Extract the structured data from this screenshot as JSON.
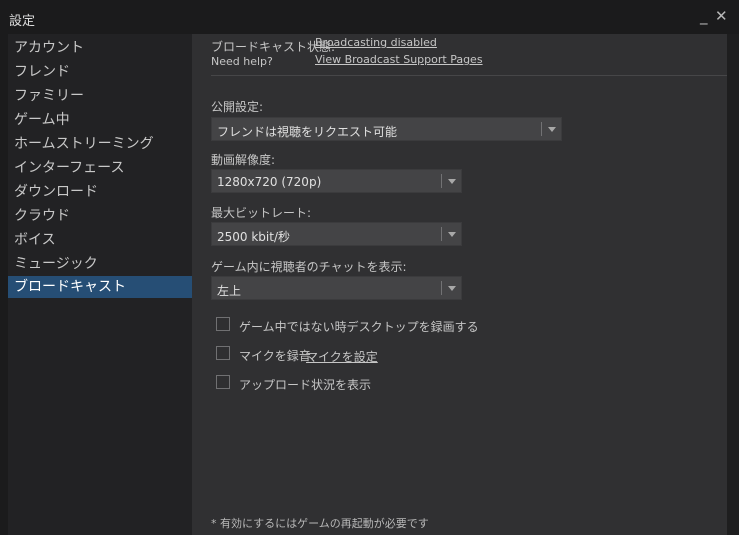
{
  "window": {
    "title": "設定",
    "minimize_glyph": "_",
    "close_glyph": "✕"
  },
  "sidebar": {
    "items": [
      {
        "label": "アカウント",
        "active": false
      },
      {
        "label": "フレンド",
        "active": false
      },
      {
        "label": "ファミリー",
        "active": false
      },
      {
        "label": "ゲーム中",
        "active": false
      },
      {
        "label": "ホームストリーミング",
        "active": false
      },
      {
        "label": "インターフェース",
        "active": false
      },
      {
        "label": "ダウンロード",
        "active": false
      },
      {
        "label": "クラウド",
        "active": false
      },
      {
        "label": "ボイス",
        "active": false
      },
      {
        "label": "ミュージック",
        "active": false
      },
      {
        "label": "ブロードキャスト",
        "active": true
      }
    ]
  },
  "broadcast": {
    "status_label": "ブロードキャスト状態:",
    "status_value": "Broadcasting disabled",
    "help_label": "Need help?",
    "help_link": "View Broadcast Support Pages",
    "privacy": {
      "label": "公開設定:",
      "value": "フレンドは視聴をリクエスト可能"
    },
    "resolution": {
      "label": "動画解像度:",
      "value": "1280x720 (720p)"
    },
    "bitrate": {
      "label": "最大ビットレート:",
      "value": "2500 kbit/秒"
    },
    "chat": {
      "label": "ゲーム内に視聴者のチャットを表示:",
      "value": "左上"
    },
    "checkboxes": {
      "record_desktop": {
        "label": "ゲーム中ではない時デスクトップを録画する",
        "checked": false
      },
      "record_mic": {
        "label": "マイクを録音",
        "checked": false,
        "link": "マイクを設定"
      },
      "upload_status": {
        "label": "アップロード状況を表示",
        "checked": false
      }
    },
    "footnote": "* 有効にするにはゲームの再起動が必要です"
  },
  "colors": {
    "active_item": "#264e75",
    "panel_bg": "#303032",
    "sidebar_bg": "#222224",
    "dropdown_bg": "#444446"
  }
}
